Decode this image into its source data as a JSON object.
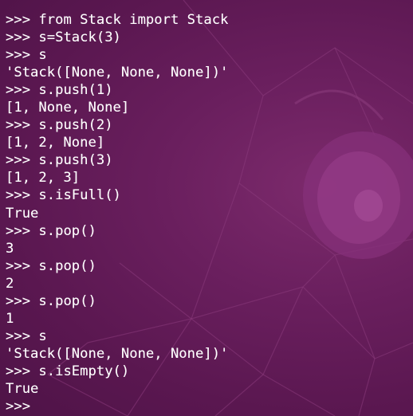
{
  "terminal": {
    "lines": [
      {
        "type": "input",
        "prompt": ">>>",
        "text": "from Stack import Stack"
      },
      {
        "type": "input",
        "prompt": ">>>",
        "text": "s=Stack(3)"
      },
      {
        "type": "input",
        "prompt": ">>>",
        "text": "s"
      },
      {
        "type": "output",
        "text": "'Stack([None, None, None])'"
      },
      {
        "type": "input",
        "prompt": ">>>",
        "text": "s.push(1)"
      },
      {
        "type": "output",
        "text": "[1, None, None]"
      },
      {
        "type": "input",
        "prompt": ">>>",
        "text": "s.push(2)"
      },
      {
        "type": "output",
        "text": "[1, 2, None]"
      },
      {
        "type": "input",
        "prompt": ">>>",
        "text": "s.push(3)"
      },
      {
        "type": "output",
        "text": "[1, 2, 3]"
      },
      {
        "type": "input",
        "prompt": ">>>",
        "text": "s.isFull()"
      },
      {
        "type": "output",
        "text": "True"
      },
      {
        "type": "input",
        "prompt": ">>>",
        "text": "s.pop()"
      },
      {
        "type": "output",
        "text": "3"
      },
      {
        "type": "input",
        "prompt": ">>>",
        "text": "s.pop()"
      },
      {
        "type": "output",
        "text": "2"
      },
      {
        "type": "input",
        "prompt": ">>>",
        "text": "s.pop()"
      },
      {
        "type": "output",
        "text": "1"
      },
      {
        "type": "input",
        "prompt": ">>>",
        "text": "s"
      },
      {
        "type": "output",
        "text": "'Stack([None, None, None])'"
      },
      {
        "type": "input",
        "prompt": ">>>",
        "text": "s.isEmpty()"
      },
      {
        "type": "output",
        "text": "True"
      },
      {
        "type": "input",
        "prompt": ">>>",
        "text": ""
      }
    ]
  },
  "theme": {
    "background": "#5c1a52",
    "foreground": "#ffffff"
  }
}
